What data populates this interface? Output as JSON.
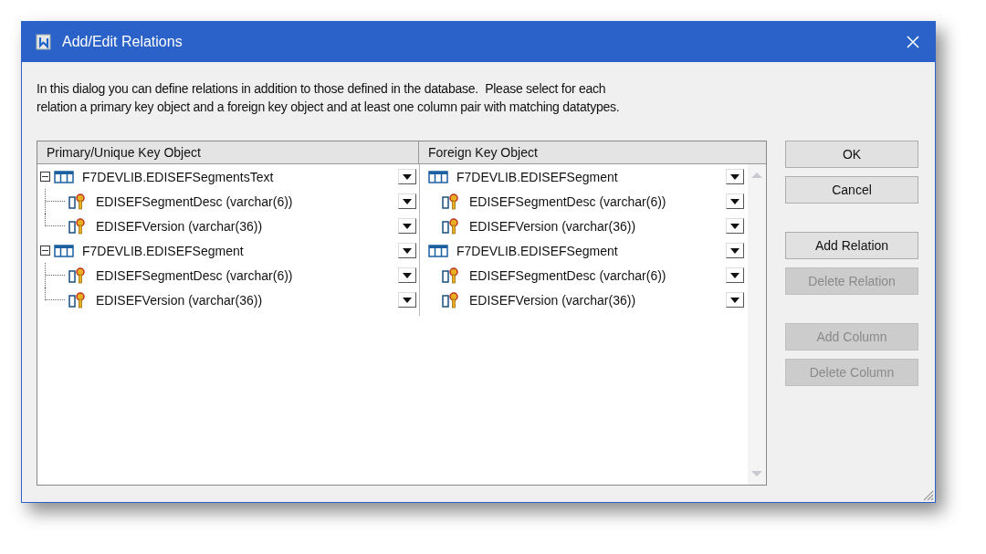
{
  "window": {
    "title": "Add/Edit Relations"
  },
  "intro": "In this dialog you can define relations in addition to those defined in the database.  Please select for each\nrelation a primary key object and a foreign key object and at least one column pair with matching datatypes.",
  "table": {
    "columns": [
      "Primary/Unique Key Object",
      "Foreign Key Object"
    ],
    "primary": [
      {
        "name": "F7DEVLIB.EDISEFSegmentsText",
        "expanded": true,
        "children": [
          {
            "name": "EDISEFSegmentDesc (varchar(6))"
          },
          {
            "name": "EDISEFVersion (varchar(36))"
          }
        ]
      },
      {
        "name": "F7DEVLIB.EDISEFSegment",
        "expanded": true,
        "children": [
          {
            "name": "EDISEFSegmentDesc (varchar(6))"
          },
          {
            "name": "EDISEFVersion (varchar(36))"
          }
        ]
      }
    ],
    "foreign": [
      {
        "name": "F7DEVLIB.EDISEFSegment",
        "children": [
          {
            "name": "EDISEFSegmentDesc (varchar(6))"
          },
          {
            "name": "EDISEFVersion (varchar(36))"
          }
        ]
      },
      {
        "name": "F7DEVLIB.EDISEFSegment",
        "children": [
          {
            "name": "EDISEFSegmentDesc (varchar(6))"
          },
          {
            "name": "EDISEFVersion (varchar(36))"
          }
        ]
      }
    ]
  },
  "button_groups": [
    [
      {
        "label": "OK",
        "disabled": false
      },
      {
        "label": "Cancel",
        "disabled": false
      }
    ],
    [
      {
        "label": "Add Relation",
        "disabled": false
      },
      {
        "label": "Delete Relation",
        "disabled": true
      }
    ],
    [
      {
        "label": "Add Column",
        "disabled": true
      },
      {
        "label": "Delete Column",
        "disabled": true
      }
    ]
  ]
}
